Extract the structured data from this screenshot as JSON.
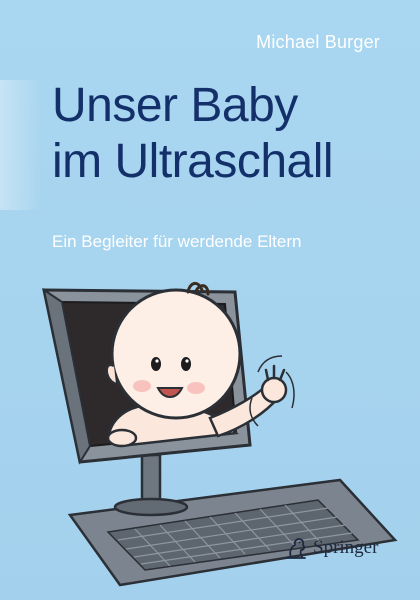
{
  "book": {
    "author": "Michael Burger",
    "title_lines": [
      "Unser Baby",
      "im Ultraschall"
    ],
    "subtitle": "Ein Begleiter für werdende Eltern",
    "publisher": "Springer"
  },
  "colors": {
    "background": "#a6d3ee",
    "title": "#14306a",
    "author_subtitle": "#ffffff"
  },
  "icons": [
    "springer-horse-logo-icon"
  ]
}
